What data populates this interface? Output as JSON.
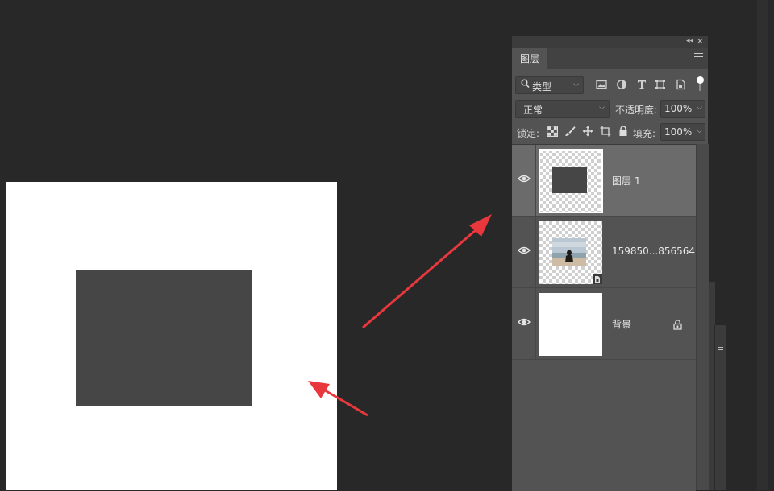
{
  "panel": {
    "tab": "图层",
    "filter": {
      "label": "类型"
    },
    "blend": {
      "mode": "正常",
      "opacity_label": "不透明度:",
      "opacity_value": "100%"
    },
    "lock": {
      "label": "锁定:",
      "fill_label": "填充:",
      "fill_value": "100%"
    },
    "layers": [
      {
        "name": "图层 1",
        "selected": true
      },
      {
        "name": "159850...856564",
        "selected": false
      },
      {
        "name": "背景",
        "selected": false
      }
    ]
  },
  "colors": {
    "workspace": "#282828",
    "panel": "#535353",
    "selected_layer": "#6b6b6b",
    "shape": "#464646",
    "arrow": "#e8383d"
  }
}
